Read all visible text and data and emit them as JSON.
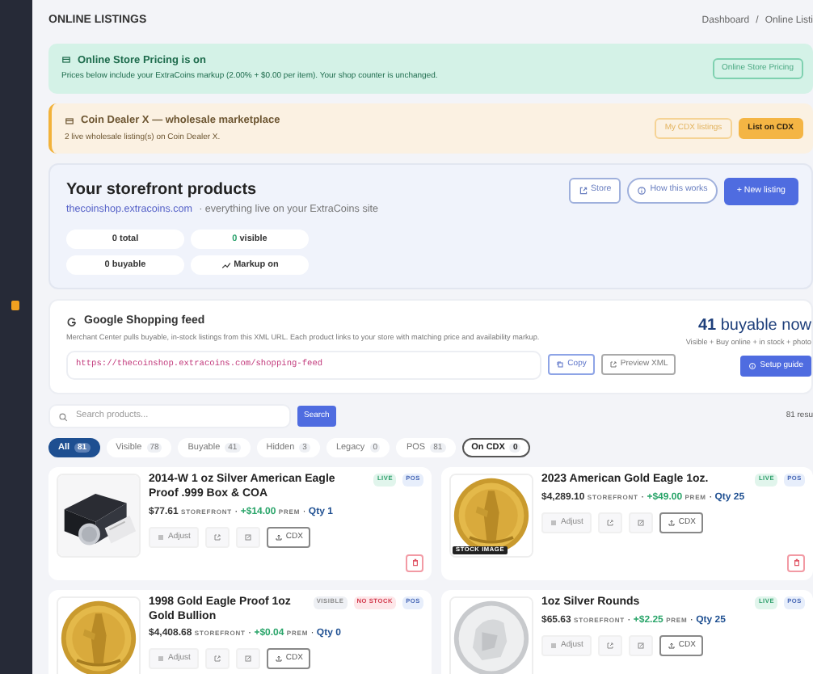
{
  "page_title": "ONLINE LISTINGS",
  "breadcrumb": {
    "items": [
      "Dashboard",
      "Online Listi"
    ],
    "separator": "/"
  },
  "alerts": [
    {
      "kind": "success",
      "title": "Online Store Pricing is on",
      "text": "Prices below include your ExtraCoins markup (2.00% + $0.00 per item). Your shop counter is unchanged.",
      "buttons": [
        {
          "label": "Online Store Pricing",
          "kind": "outline"
        }
      ]
    },
    {
      "kind": "warning",
      "title": "Coin Dealer X — wholesale marketplace",
      "text": "2 live wholesale listing(s) on Coin Dealer X.",
      "buttons": [
        {
          "label": "My CDX listings",
          "kind": "outline"
        },
        {
          "label": "List on CDX",
          "kind": "solid"
        }
      ]
    }
  ],
  "storefront": {
    "title": "Your storefront products",
    "link": "thecoinshop.extracoins.com",
    "subtitle": "· everything live on your ExtraCoins site",
    "buttons": [
      {
        "label": "Store",
        "kind": "outline"
      },
      {
        "label": "How this works",
        "kind": "pill"
      },
      {
        "label": "+ New listing",
        "kind": "solid"
      }
    ],
    "stats": [
      {
        "value": "0",
        "label": "total",
        "kind": "plain"
      },
      {
        "value": "0",
        "label": "visible",
        "kind": "green"
      },
      {
        "value": "0",
        "label": "buyable",
        "kind": "plain"
      },
      {
        "label": "Markup on",
        "kind": "trend"
      }
    ]
  },
  "feed": {
    "title": "Google Shopping feed",
    "description": "Merchant Center pulls buyable, in-stock listings from this XML URL. Each product links to your store with matching price and availability markup.",
    "url": "https://thecoinshop.extracoins.com/shopping-feed",
    "buttons": [
      {
        "label": "Copy",
        "kind": "primary"
      },
      {
        "label": "Preview XML",
        "kind": "secondary"
      }
    ],
    "count": "41",
    "count_label": "buyable now",
    "note": "Visible + Buy online + in stock + photo",
    "guide": "Setup guide"
  },
  "search": {
    "placeholder": "Search products...",
    "button": "Search",
    "results": "81 resu"
  },
  "filters": [
    {
      "label": "All",
      "count": "81",
      "selected": true,
      "kind": "status"
    },
    {
      "label": "Visible",
      "count": "78",
      "selected": false,
      "kind": "status"
    },
    {
      "label": "Buyable",
      "count": "41",
      "selected": false,
      "kind": "status"
    },
    {
      "label": "Hidden",
      "count": "3",
      "selected": false,
      "kind": "status"
    },
    {
      "label": "Legacy",
      "count": "0",
      "selected": false,
      "kind": "status"
    },
    {
      "label": "POS",
      "count": "81",
      "selected": false,
      "kind": "status"
    },
    {
      "label": "On CDX",
      "count": "0",
      "selected": false,
      "kind": "cdx"
    }
  ],
  "products": [
    {
      "title": "2014-W 1 oz Silver American Eagle Proof .999 Box & COA",
      "badges": [
        {
          "label": "LIVE",
          "kind": "live"
        },
        {
          "label": "POS",
          "kind": "pos"
        }
      ],
      "price": "$77.61",
      "price_label": "STOREFRONT",
      "premium": "+$14.00",
      "premium_label": "PREM",
      "qty": "Qty 1",
      "separator": "·",
      "actions": [
        "Adjust",
        "CDX"
      ],
      "deletable": true
    },
    {
      "title": "2023 American Gold Eagle 1oz.",
      "badges": [
        {
          "label": "LIVE",
          "kind": "live"
        },
        {
          "label": "POS",
          "kind": "pos"
        }
      ],
      "price": "$4,289.10",
      "price_label": "STOREFRONT",
      "premium": "+$49.00",
      "premium_label": "PREM",
      "qty": "Qty 25",
      "separator": "·",
      "caption": "STOCK IMAGE",
      "actions": [
        "Adjust",
        "CDX"
      ],
      "deletable": true
    },
    {
      "title": "1998 Gold Eagle Proof 1oz Gold Bullion",
      "badges": [
        {
          "label": "VISIBLE",
          "kind": "muted"
        },
        {
          "label": "NO STOCK",
          "kind": "danger"
        },
        {
          "label": "POS",
          "kind": "pos"
        }
      ],
      "price": "$4,408.68",
      "price_label": "STOREFRONT",
      "premium": "+$0.04",
      "premium_label": "PREM",
      "qty": "Qty 0",
      "separator": "·",
      "actions": [
        "Adjust",
        "CDX"
      ],
      "deletable": false
    },
    {
      "title": "1oz Silver Rounds",
      "badges": [
        {
          "label": "LIVE",
          "kind": "live"
        },
        {
          "label": "POS",
          "kind": "pos"
        }
      ],
      "price": "$65.63",
      "price_label": "STOREFRONT",
      "premium": "+$2.25",
      "premium_label": "PREM",
      "qty": "Qty 25",
      "separator": "·",
      "actions": [
        "Adjust",
        "CDX"
      ],
      "deletable": false
    }
  ]
}
